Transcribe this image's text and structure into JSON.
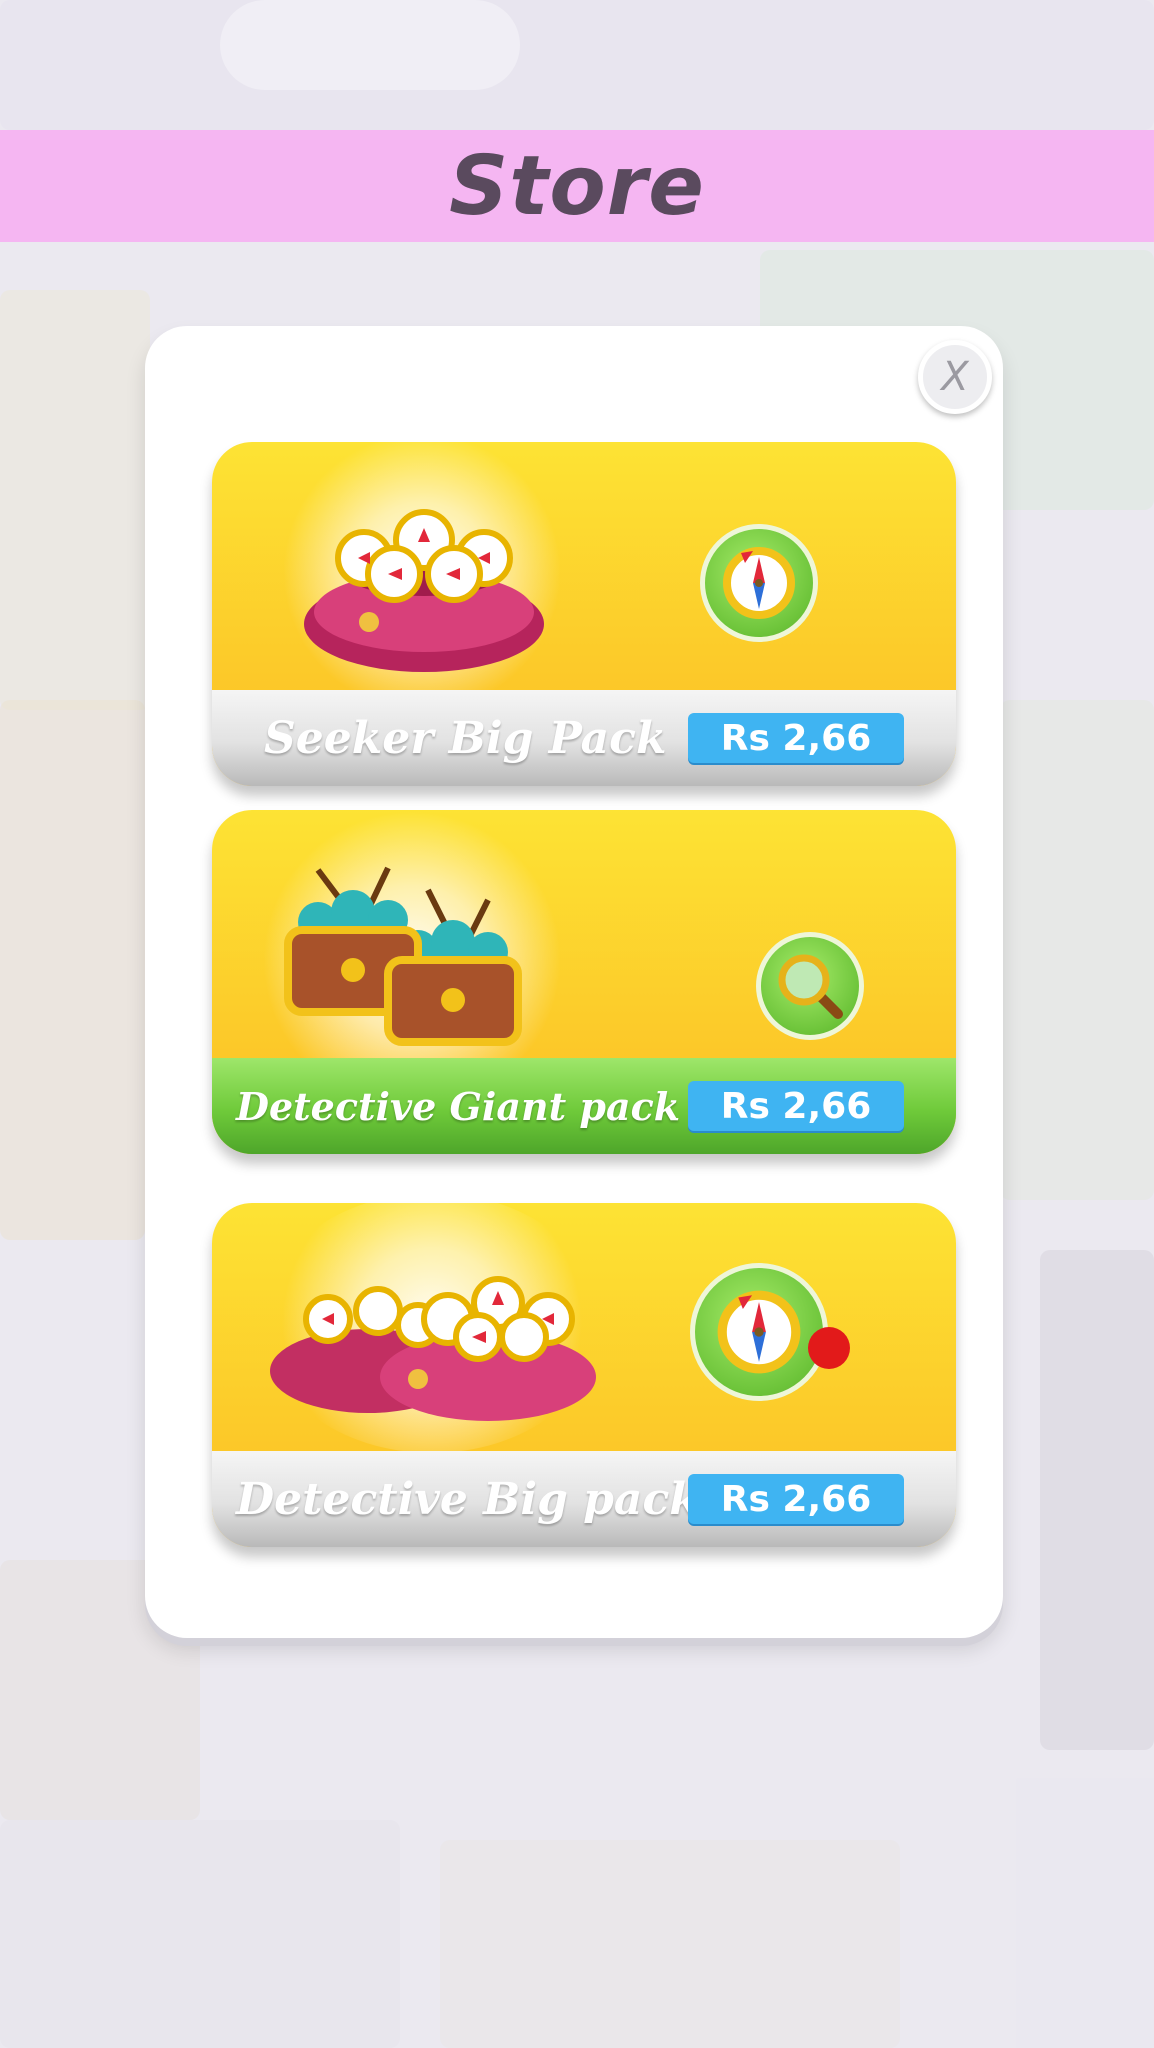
{
  "header": {
    "title": "Store"
  },
  "close": {
    "label": "X"
  },
  "products": [
    {
      "name": "Seeker Big Pack",
      "price": "Rs 2,66",
      "icon": "compass-icon"
    },
    {
      "name": "Detective Giant pack",
      "price": "Rs 2,66",
      "icon": "magnifier-icon"
    },
    {
      "name": "Detective Big pack",
      "price": "Rs 2,66",
      "icon": "compass-icon"
    }
  ],
  "colors": {
    "banner": "#f5b6f2",
    "title": "#5a4a5e",
    "card_top": "#fde334",
    "card_bottom": "#fcbd24",
    "price_button": "#3fb4f2",
    "green_footer": "#6fca3a",
    "notification_dot": "#e21a1a"
  }
}
